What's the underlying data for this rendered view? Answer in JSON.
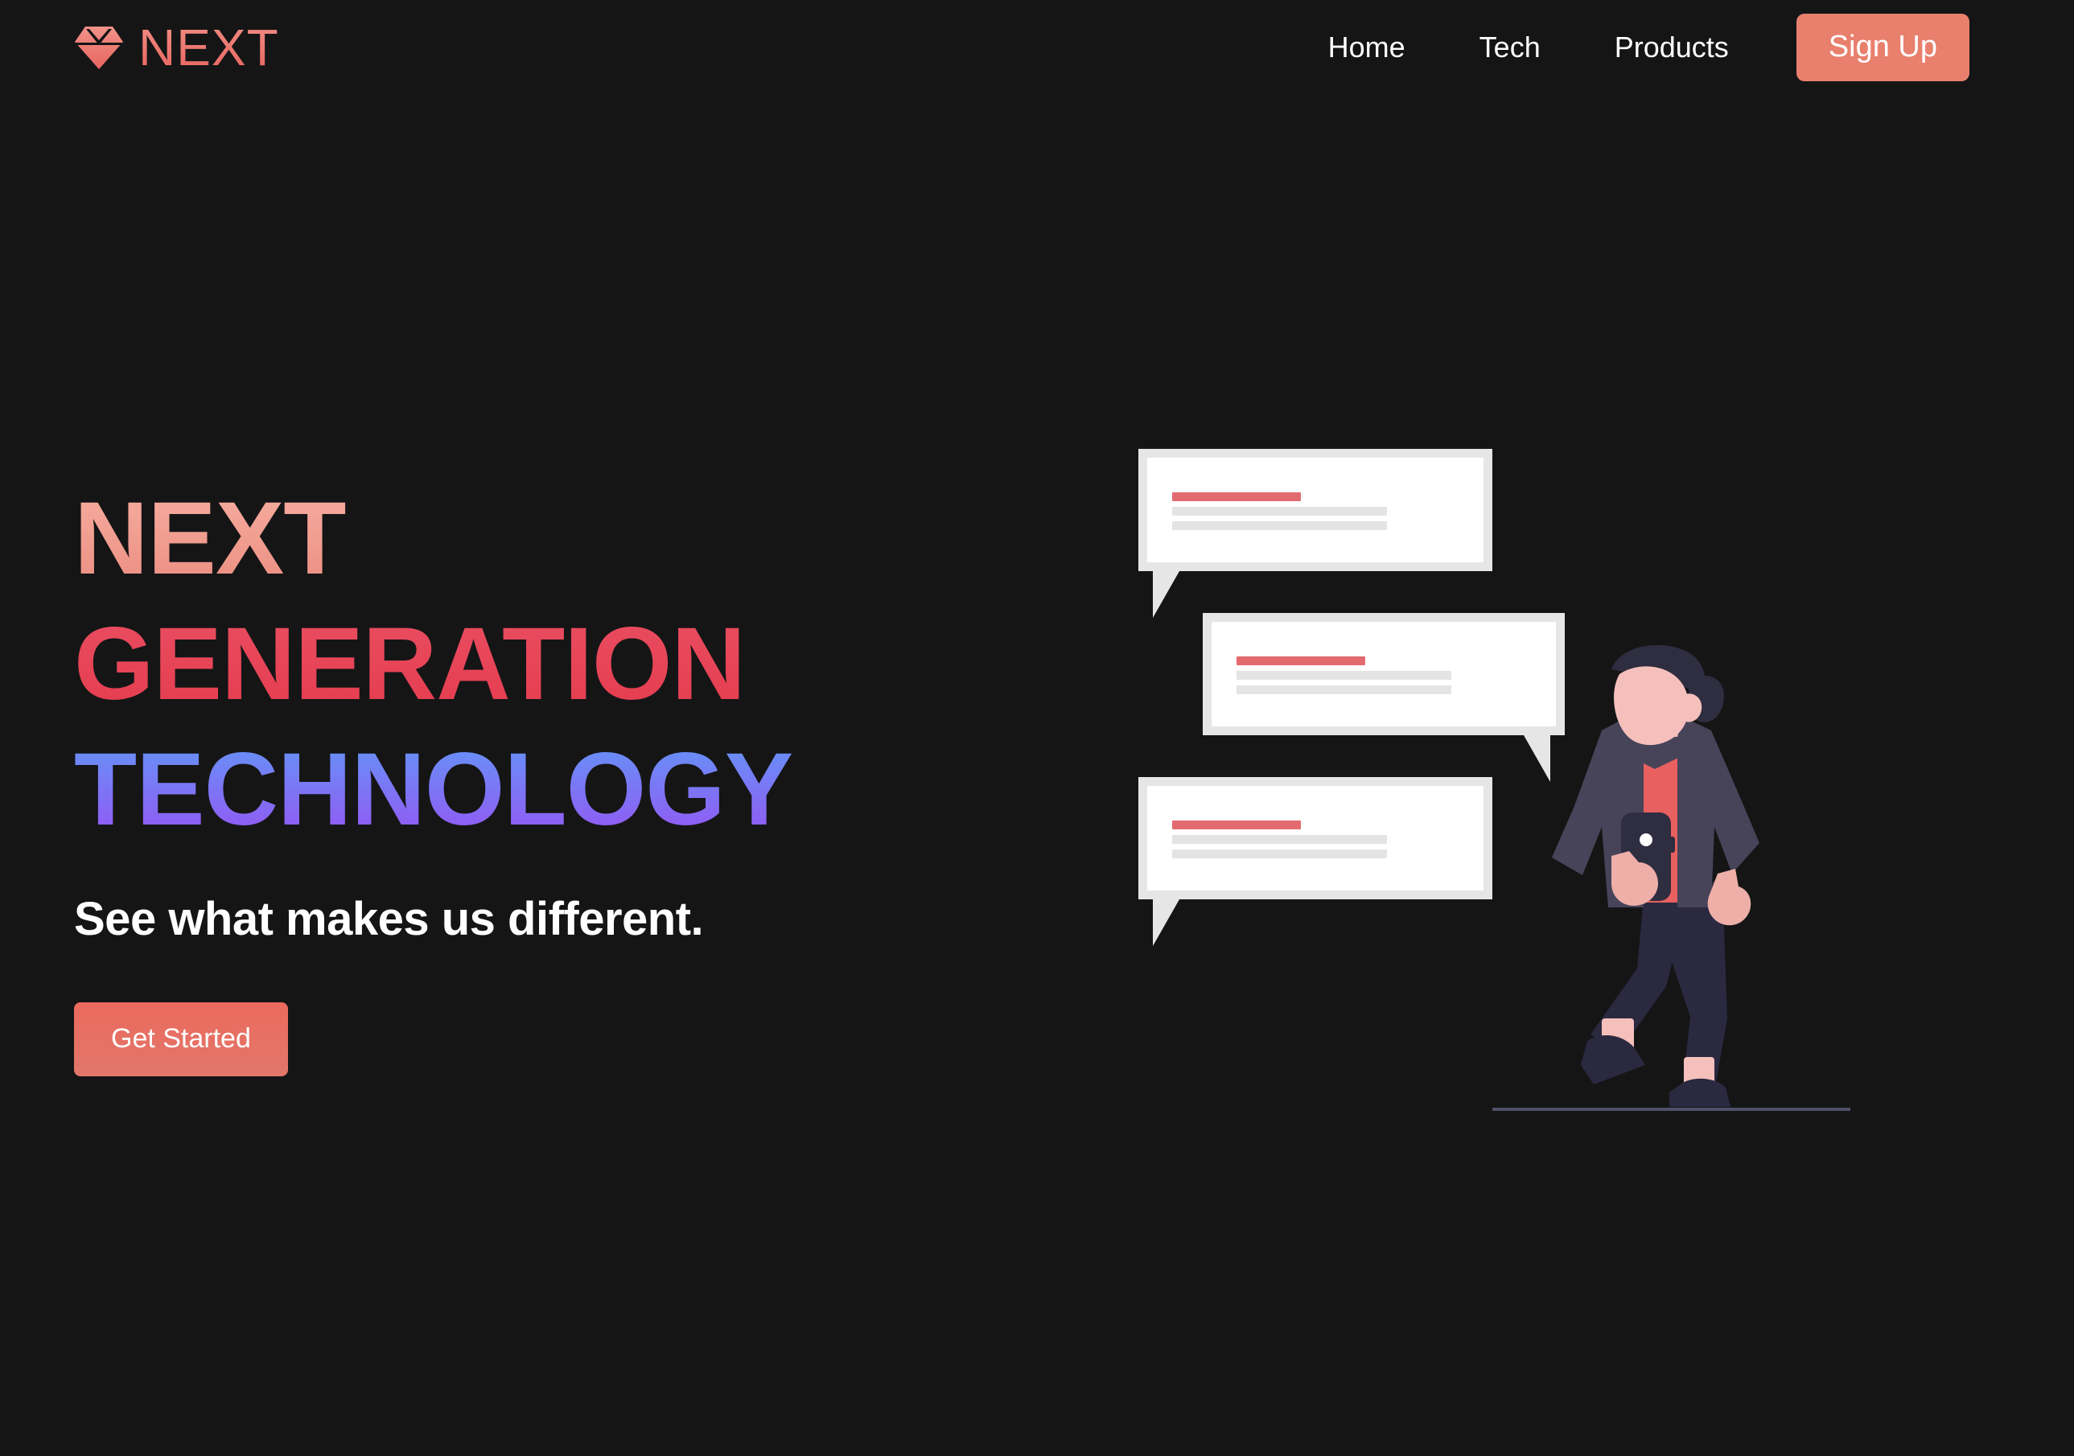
{
  "brand": {
    "name": "NEXT",
    "logo_icon": "diamond-gem-icon",
    "accent_color": "#e8655f"
  },
  "nav": {
    "links": [
      {
        "label": "Home"
      },
      {
        "label": "Tech"
      },
      {
        "label": "Products"
      }
    ],
    "signup_label": "Sign Up",
    "signup_color": "#e8806d"
  },
  "hero": {
    "headline_line1": "NEXT",
    "headline_line2": "GENERATION",
    "headline_line3": "TECHNOLOGY",
    "headline_line1_color": "#f0a195",
    "headline_line2_color": "#e8455a",
    "headline_line3_gradient_from": "#5e9cf8",
    "headline_line3_gradient_to": "#9b4ef2",
    "subheadline": "See what makes us different.",
    "cta_label": "Get Started",
    "cta_color": "#ec6a5e"
  },
  "illustration": {
    "name": "chat-bubbles-and-businessman-illustration",
    "background_color": "#151516",
    "bubble_frame_color": "#e6e6e6",
    "bubble_sheet_color": "#ffffff",
    "bubble_accent_line_color": "#e36b70",
    "bubble_placeholder_line_color": "#e4e4e4",
    "ground_line_color": "#50506a",
    "bubbles": [
      {
        "id": "bubble-1",
        "tail": "down-left"
      },
      {
        "id": "bubble-2",
        "tail": "down-right"
      },
      {
        "id": "bubble-3",
        "tail": "down-left"
      }
    ],
    "person": {
      "hair_color": "#2f2d40",
      "skin_color": "#f5c0bc",
      "suit_color": "#474459",
      "shirt_color": "#e8605f",
      "trouser_color": "#2b2940",
      "phone_color": "#2f2d40"
    }
  }
}
